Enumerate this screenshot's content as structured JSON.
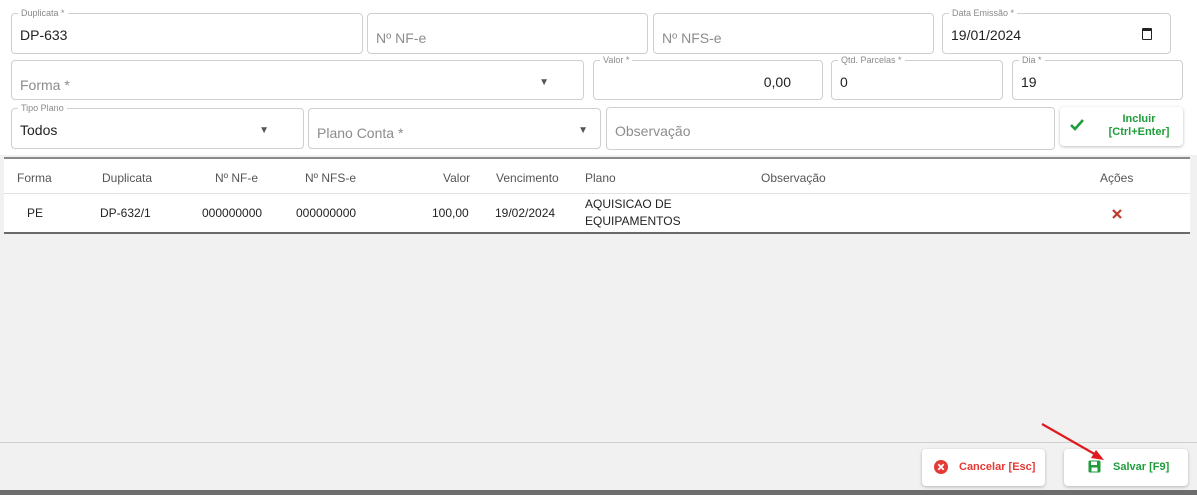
{
  "form": {
    "duplicata": {
      "label": "Duplicata *",
      "value": "DP-633"
    },
    "nfe": {
      "placeholder": "Nº NF-e"
    },
    "nfse": {
      "placeholder": "Nº NFS-e"
    },
    "data_emissao": {
      "label": "Data Emissão *",
      "value": "19/01/2024"
    },
    "forma": {
      "placeholder": "Forma *"
    },
    "valor": {
      "label": "Valor *",
      "value": "0,00"
    },
    "qtd_parcelas": {
      "label": "Qtd. Parcelas *",
      "value": "0"
    },
    "dia": {
      "label": "Dia *",
      "value": "19"
    },
    "tipo_plano": {
      "label": "Tipo Plano",
      "value": "Todos"
    },
    "plano_conta": {
      "placeholder": "Plano Conta *"
    },
    "observacao": {
      "placeholder": "Observação"
    },
    "incluir": {
      "line1": "Incluir",
      "line2": "[Ctrl+Enter]"
    }
  },
  "table": {
    "headers": {
      "forma": "Forma",
      "duplicata": "Duplicata",
      "nfe": "Nº NF-e",
      "nfse": "Nº NFS-e",
      "valor": "Valor",
      "vencimento": "Vencimento",
      "plano": "Plano",
      "observacao": "Observação",
      "acoes": "Ações"
    },
    "rows": [
      {
        "forma": "PE",
        "duplicata": "DP-632/1",
        "nfe": "000000000",
        "nfse": "000000000",
        "valor": "100,00",
        "vencimento": "19/02/2024",
        "plano_line1": "AQUISICAO DE",
        "plano_line2": "EQUIPAMENTOS",
        "observacao": "",
        "action_icon": "delete-x-icon"
      }
    ]
  },
  "footer": {
    "cancel_label": "Cancelar [Esc]",
    "save_label": "Salvar [F9]"
  },
  "colors": {
    "green": "#1f9d3a",
    "red": "#e53935",
    "delete_red": "#c0392b",
    "annotation_arrow": "#e0191f"
  }
}
